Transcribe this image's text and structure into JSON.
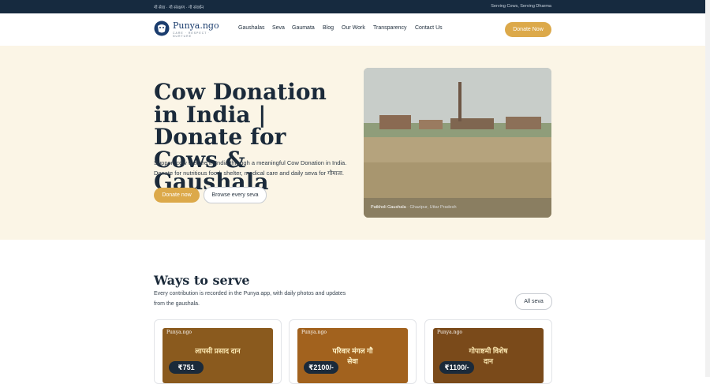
{
  "topbar": {
    "left_text": "गौ सेवा · गौ संरक्षण · गौ संवर्धन",
    "right_text": "Serving Cows, Serving Dharma"
  },
  "logo": {
    "name": "Punya.ngo",
    "tagline": "CARE · RESPECT · NURTURE"
  },
  "nav": {
    "items": [
      "Gaushalas",
      "Seva",
      "Gaumata",
      "Blog",
      "Our Work",
      "Transparency",
      "Contact Us"
    ],
    "donate_label": "Donate Now"
  },
  "hero": {
    "title": "Cow Donation in India | Donate for Cows & Gaushala",
    "text": "Support cow welfare in India through a meaningful Cow Donation in India. Donate for nutritious food, shelter, medical care and daily seva for गौमाता.",
    "primary_button": "Donate now",
    "secondary_button": "Browse every seva",
    "image_caption": "Patkholi Gaushala",
    "image_location": "· Ghazipur, Uttar Pradesh"
  },
  "ways": {
    "title": "Ways to serve",
    "text": "Every contribution is recorded in the Punya app, with daily photos and updates from the gaushala.",
    "all_button": "All seva"
  },
  "cards": [
    {
      "brand": "Punya.ngo",
      "banner": "लापसी प्रसाद दान",
      "price": "₹751",
      "color": "#8a5a1e"
    },
    {
      "brand": "Punya.ngo",
      "banner": "परिवार मंगल गौ सेवा",
      "price": "₹2100/-",
      "color": "#a2621e"
    },
    {
      "brand": "Punya.ngo",
      "banner": "गोपाष्टमी विशेष दान",
      "price": "₹1100/-",
      "color": "#7a4a1a"
    }
  ],
  "colors": {
    "accent": "#dca94a",
    "dark_navy": "#162a3f",
    "hero_bg": "#fbf5e6"
  }
}
